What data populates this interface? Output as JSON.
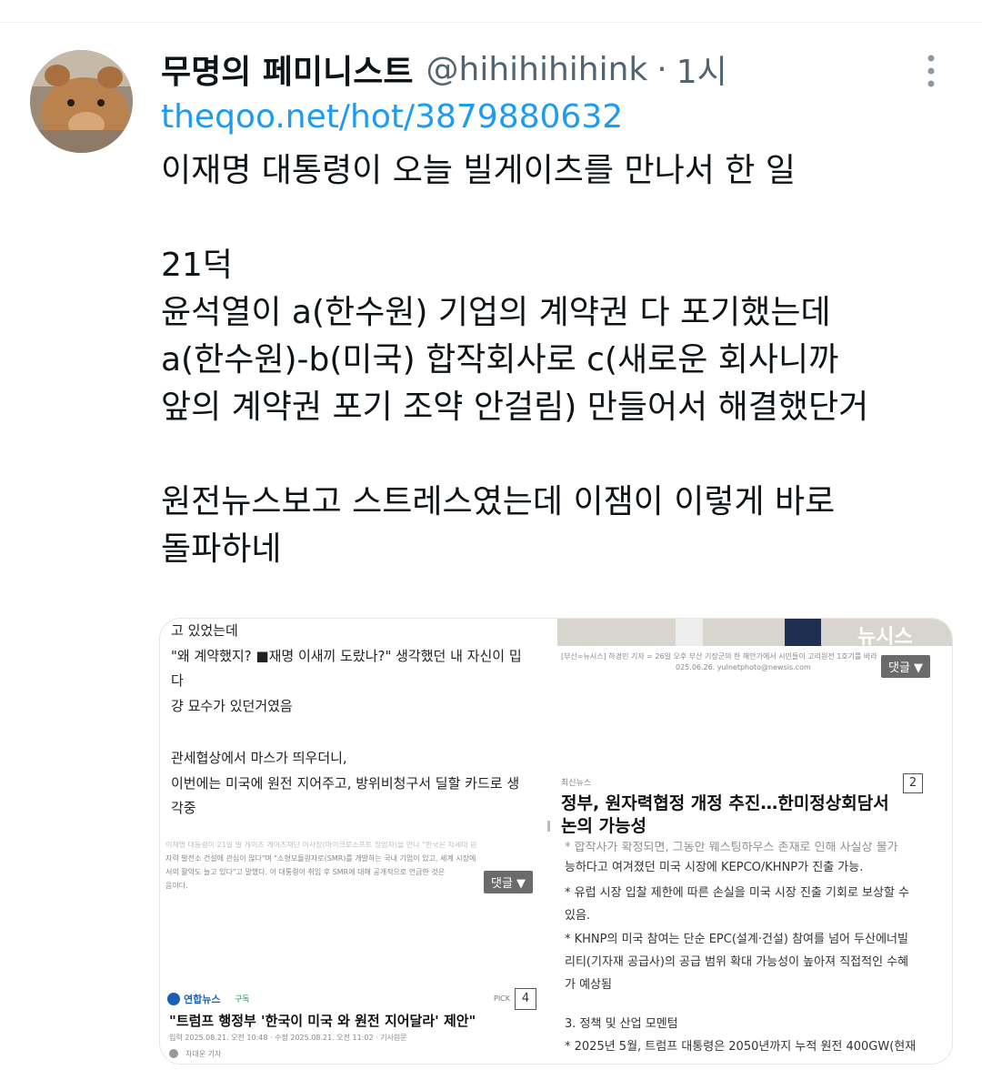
{
  "author": {
    "display_name": "무명의 페미니스트",
    "handle": "@hihihihihink",
    "separator": "·",
    "time": "1시"
  },
  "tweet": {
    "link": "theqoo.net/hot/3879880632",
    "lines": [
      "이재명 대통령이 오늘 빌게이츠를 만나서 한 일",
      "",
      "21덕",
      "윤석열이 a(한수원) 기업의 계약권 다 포기했는데",
      "a(한수원)-b(미국) 합작회사로 c(새로운 회사니까",
      "앞의 계약권 포기 조약 안걸림) 만들어서 해결했단거",
      "",
      "원전뉴스보고 스트레스였는데 이잼이 이렇게 바로",
      "돌파하네"
    ]
  },
  "media": {
    "tile1": {
      "lines": [
        "고 있었는데",
        "\"왜 계약했지? ■재명 이새끼 도랐나?\" 생각했던 내 자신이 밉",
        "다",
        "걍 묘수가 있던거였음",
        "",
        "관세협상에서 마스가 띄우더니,",
        "이번에는 미국에 원전 지어주고, 방위비청구서 딜할 카드로 생",
        "각중"
      ]
    },
    "tile2": {
      "watermark": "뉴시스",
      "caption": "[부산=뉴시스] 하경민 기자 = 26일 오후 부산 기장군의 한 해안가에서 시민들이 고리원전 1호기를 바라",
      "caption2": "025.06.26. yulnetphoto@newsis.com",
      "comment_label": "댓글 ▼",
      "source": "최신뉴스",
      "badge": "2",
      "headline_1": "정부, 원자력협정 개정 추진…한미정상회담서",
      "headline_2": "논의 가능성"
    },
    "tile3": {
      "text_1": "이재명 대통령이 21일 빌 게이츠 게이츠재단 이사장(마이크로소프트 창업자)을 만나 \"한국은 차세대 원",
      "text_2": "자력 발전소 건설에 관심이 많다\"며 \"소형모듈원자로(SMR)를 개발하는 국내 기업이 있고, 세계 시장에",
      "text_3": "서의 활약도 늘고 있다\"고 말했다. 이 대통령이 취임 후 SMR에 대해 공개적으로 언급한 것은",
      "text_4": "음이다.",
      "comment_label": "댓글 ▼",
      "source": "연합뉴스",
      "subscribe": "구독",
      "pick": "PICK",
      "badge": "4",
      "headline": "\"트럼프 행정부 '한국이 미국 와 원전 지어달라' 제안\"",
      "dateline": "입력 2025.08.21. 오전 10:48 · 수정 2025.08.21. 오전 11:02 · 기사원문",
      "reporter": "차대운 기자"
    },
    "tile4": {
      "lines": [
        "* 합작사가 확정되면, 그동안 웨스팅하우스 존재로 인해 사실상 불가",
        "능하다고 여겨졌던 미국 시장에 KEPCO/KHNP가 진출 가능.",
        "* 유럽 시장 입찰 제한에 따른 손실을 미국 시장 진출 기회로 보상할 수",
        "있음.",
        "* KHNP의 미국 참여는 단순 EPC(설계·건설) 참여를 넘어 두산에너빌",
        "리티(기자재 공급사)의 공급 범위 확대 가능성이 높아져 직접적인 수혜",
        "가 예상됨",
        "",
        "3. 정책 및 산업 모멘텀",
        "* 2025년 5월, 트럼프 대통령은 2050년까지 누적 원전 400GW(현재"
      ]
    }
  },
  "colors": {
    "text": "#0f1419",
    "secondary": "#536471",
    "link": "#1d9bf0"
  }
}
